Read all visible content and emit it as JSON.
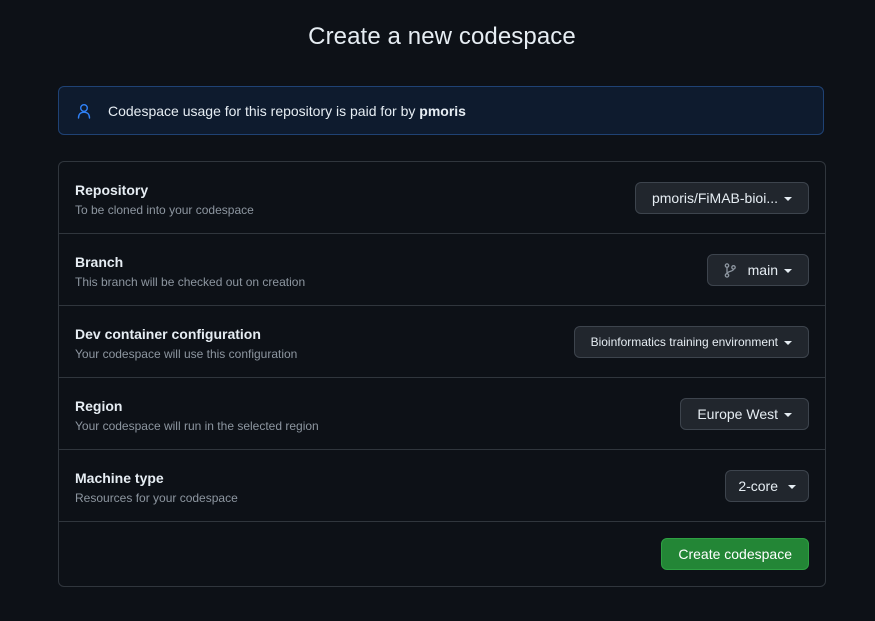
{
  "page": {
    "title": "Create a new codespace"
  },
  "flash": {
    "text_prefix": "Codespace usage for this repository is paid for by",
    "owner": "pmoris",
    "icon": "person-icon",
    "accent_color": "#2f81f7"
  },
  "settings": [
    {
      "title": "Repository",
      "description": "To be cloned into your codespace",
      "value": "pmoris/FiMAB-bioi..."
    },
    {
      "title": "Branch",
      "description": "This branch will be checked out on creation",
      "value": "main",
      "icon": "git-branch-icon"
    },
    {
      "title": "Dev container configuration",
      "description": "Your codespace will use this configuration",
      "value": "Bioinformatics training environment"
    },
    {
      "title": "Region",
      "description": "Your codespace will run in the selected region",
      "value": "Europe West"
    },
    {
      "title": "Machine type",
      "description": "Resources for your codespace",
      "value": "2-core"
    }
  ],
  "actions": {
    "create_label": "Create codespace",
    "create_color": "#238636"
  }
}
